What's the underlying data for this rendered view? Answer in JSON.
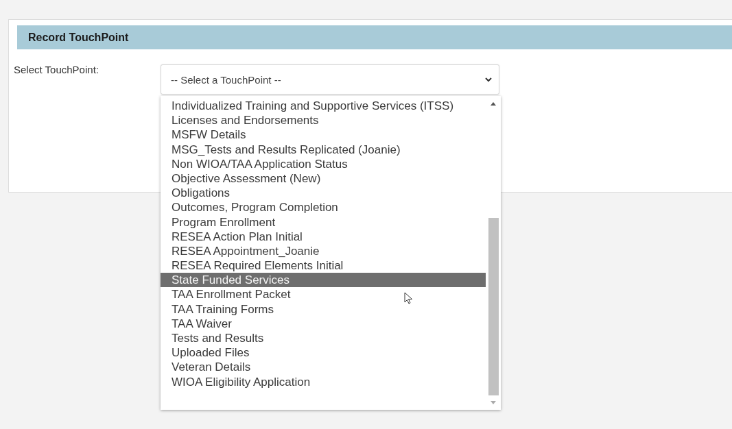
{
  "panel": {
    "title": "Record TouchPoint"
  },
  "form": {
    "label": "Select TouchPoint:",
    "select": {
      "value": "-- Select a TouchPoint --",
      "expanded": true
    }
  },
  "dropdown": {
    "options": [
      {
        "label": "Individualized Training and Supportive Services (ITSS)",
        "selected": false
      },
      {
        "label": "Licenses and Endorsements",
        "selected": false
      },
      {
        "label": "MSFW Details",
        "selected": false
      },
      {
        "label": "MSG_Tests and Results Replicated (Joanie)",
        "selected": false
      },
      {
        "label": "Non WIOA/TAA Application Status",
        "selected": false
      },
      {
        "label": "Objective Assessment (New)",
        "selected": false
      },
      {
        "label": "Obligations",
        "selected": false
      },
      {
        "label": "Outcomes, Program Completion",
        "selected": false
      },
      {
        "label": "Program Enrollment",
        "selected": false
      },
      {
        "label": "RESEA Action Plan Initial",
        "selected": false
      },
      {
        "label": "RESEA Appointment_Joanie",
        "selected": false
      },
      {
        "label": "RESEA Required Elements Initial",
        "selected": false
      },
      {
        "label": "State Funded Services",
        "selected": true
      },
      {
        "label": "TAA Enrollment Packet",
        "selected": false
      },
      {
        "label": "TAA Training Forms",
        "selected": false
      },
      {
        "label": "TAA Waiver",
        "selected": false
      },
      {
        "label": "Tests and Results",
        "selected": false
      },
      {
        "label": "Uploaded Files",
        "selected": false
      },
      {
        "label": "Veteran Details",
        "selected": false
      },
      {
        "label": "WIOA Eligibility Application",
        "selected": false
      }
    ]
  }
}
